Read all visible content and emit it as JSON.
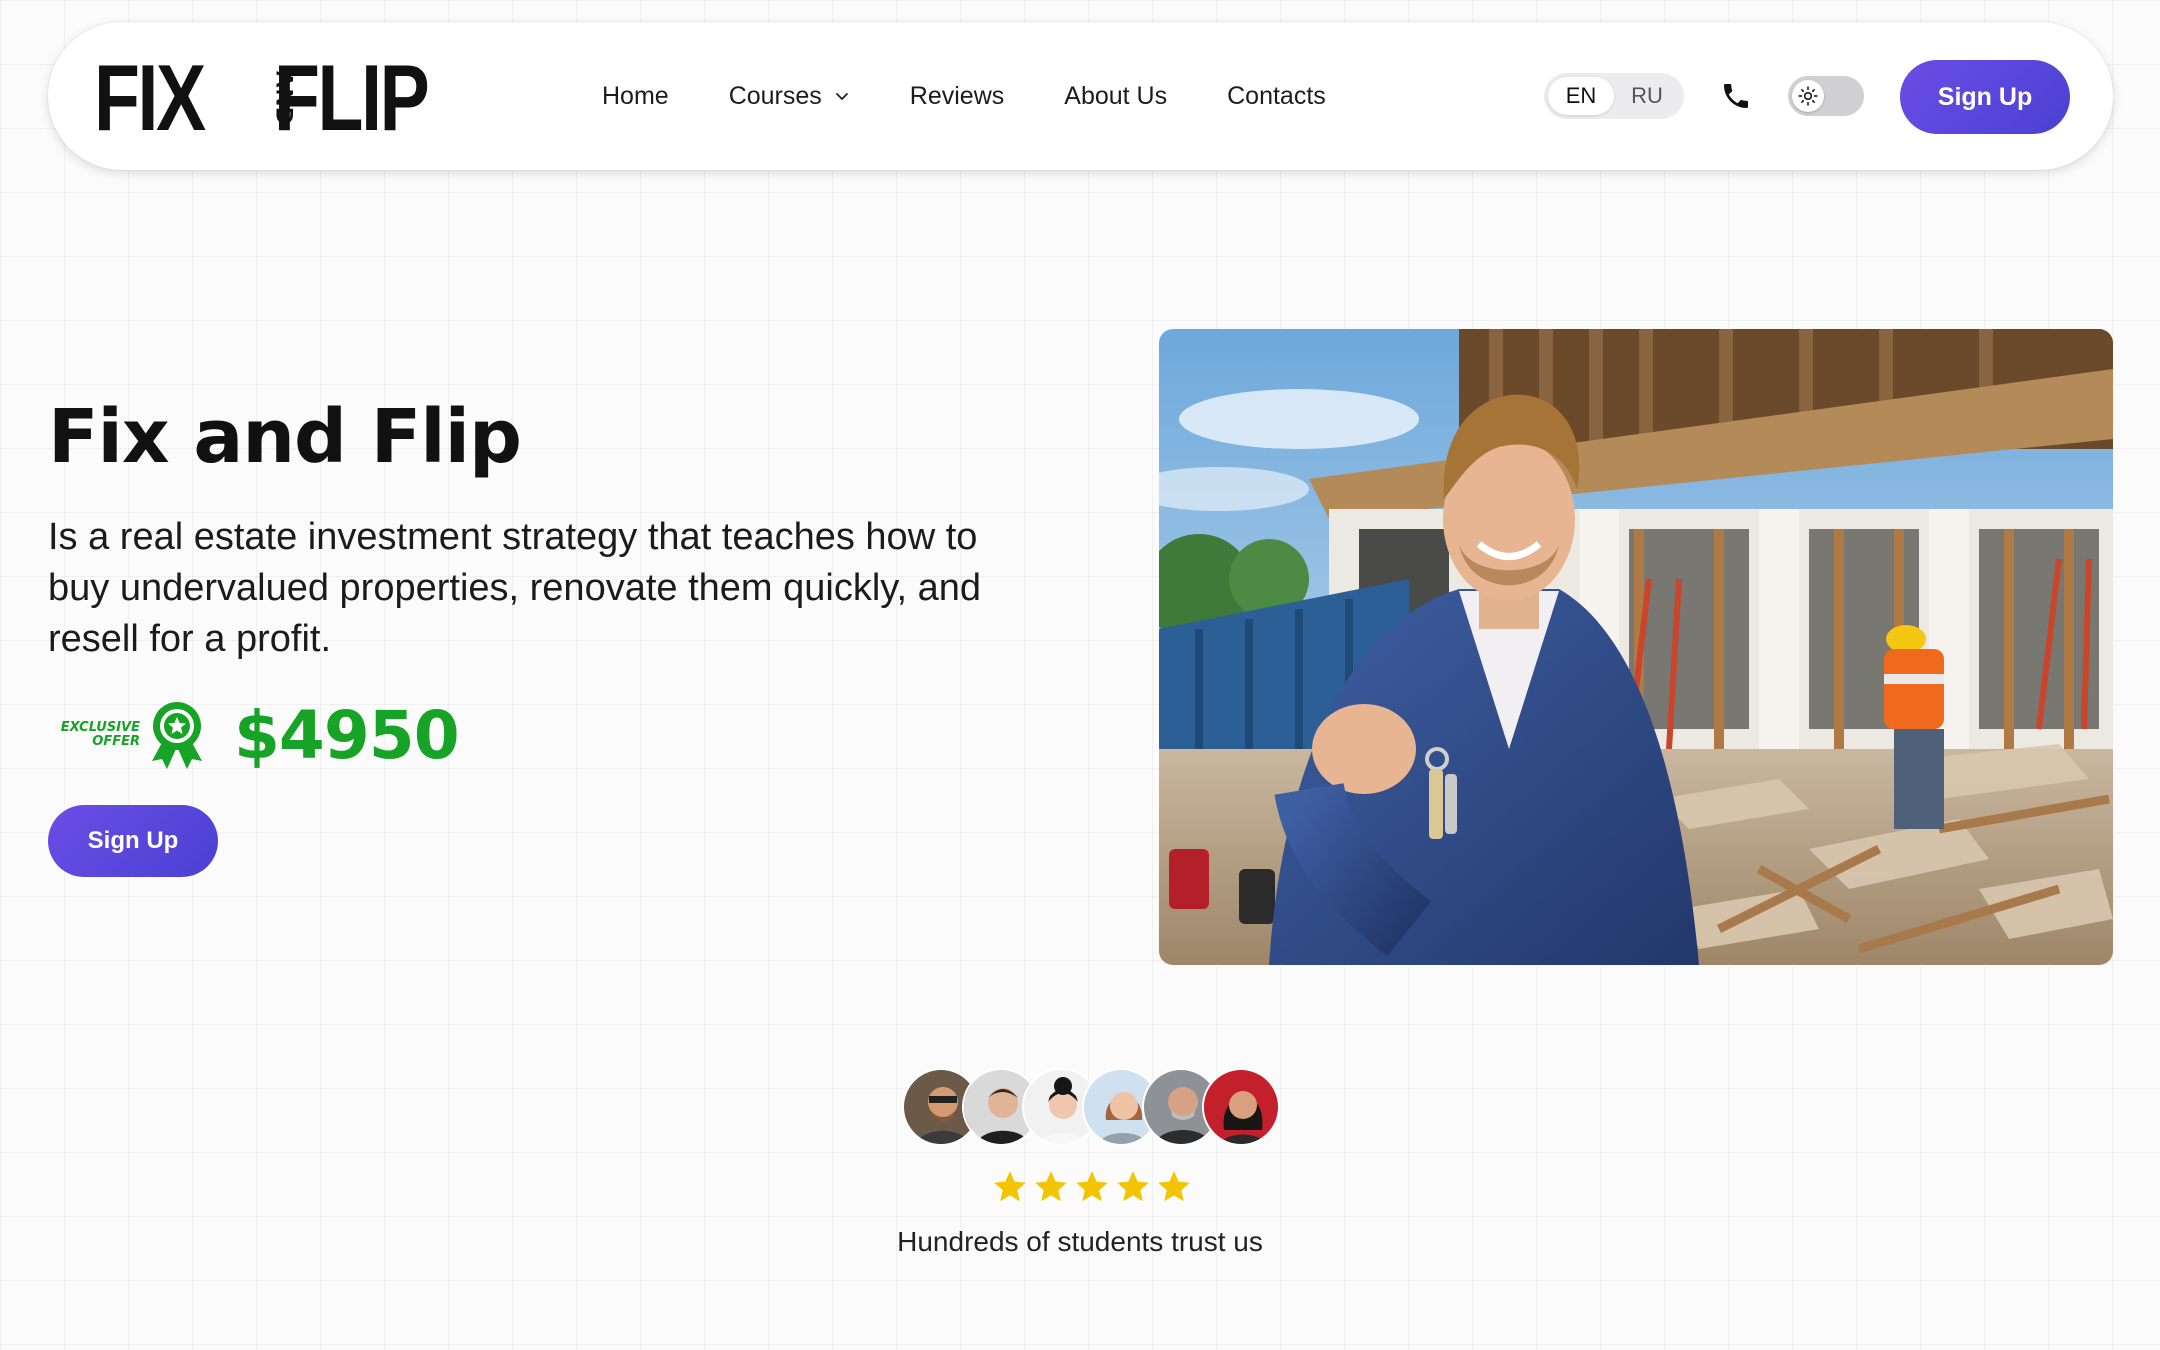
{
  "logo": {
    "word1": "FIX",
    "middle": "AND",
    "word2": "FLIP"
  },
  "nav": {
    "items": [
      {
        "label": "Home"
      },
      {
        "label": "Courses"
      },
      {
        "label": "Reviews"
      },
      {
        "label": "About Us"
      },
      {
        "label": "Contacts"
      }
    ]
  },
  "language": {
    "options": [
      "EN",
      "RU"
    ],
    "selected": "EN"
  },
  "header": {
    "signup_label": "Sign Up",
    "theme": "light"
  },
  "hero": {
    "title": "Fix and Flip",
    "description": "Is a real estate investment strategy that teaches how to buy undervalued properties, renovate them quickly, and resell for a profit.",
    "offer_line1": "EXCLUSIVE",
    "offer_line2": "OFFER",
    "price": "$4950",
    "signup_label": "Sign Up"
  },
  "trust": {
    "rating": 5,
    "rating_max": 5,
    "text": "Hundreds of students trust us"
  },
  "colors": {
    "accent": "#5a46dd",
    "price_green": "#17a325",
    "star_yellow": "#f5c400",
    "text": "#111111"
  },
  "icons": [
    "chevron-down-icon",
    "phone-icon",
    "sun-icon",
    "award-badge-icon",
    "star-icon"
  ]
}
